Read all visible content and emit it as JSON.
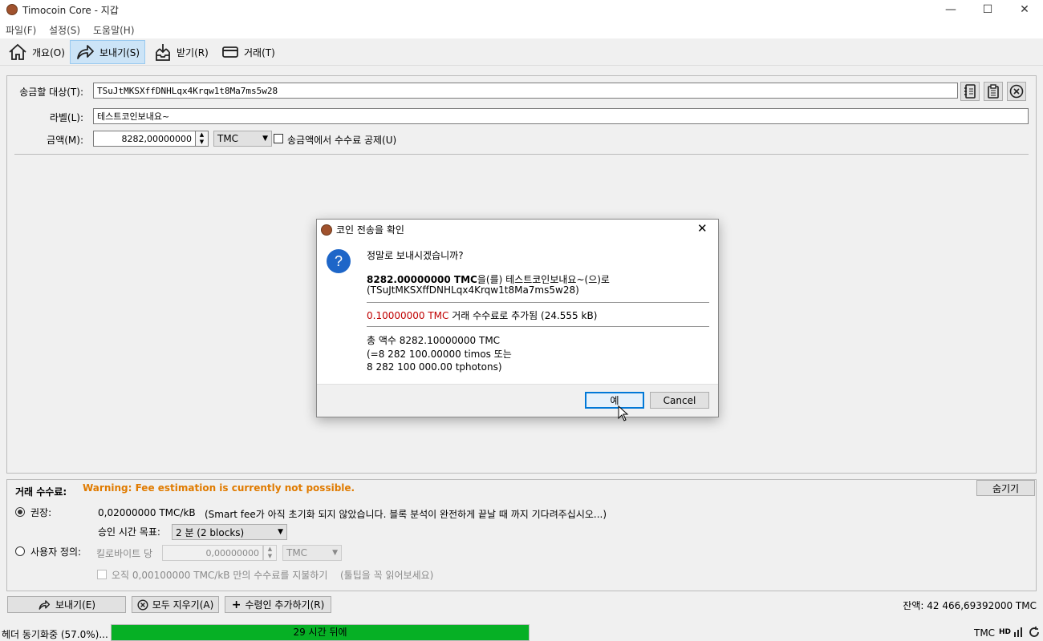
{
  "window": {
    "title": "Timocoin Core - 지갑",
    "minimize": "—",
    "maximize": "☐",
    "close": "✕"
  },
  "menu": [
    "파일(F)",
    "설정(S)",
    "도움말(H)"
  ],
  "tabs": [
    {
      "label": "개요(O)",
      "icon": "home-icon"
    },
    {
      "label": "보내기(S)",
      "icon": "send-arrow-icon",
      "active": true
    },
    {
      "label": "받기(R)",
      "icon": "inbox-icon"
    },
    {
      "label": "거래(T)",
      "icon": "card-icon"
    }
  ],
  "send_form": {
    "pay_to_label": "송금할 대상(T):",
    "pay_to_value": "TSuJtMKSXffDNHLqx4Krqw1t8Ma7ms5w28",
    "label_label": "라벨(L):",
    "label_value": "테스트코인보내요~",
    "amount_label": "금액(M):",
    "amount_value": "8282,00000000",
    "unit": "TMC",
    "subtract_fee_label": "송금액에서 수수료 공제(U)"
  },
  "dialog": {
    "title": "코인 전송을 확인",
    "question": "정말로 보내시겠습니까?",
    "amount_bold": "8282.00000000 TMC",
    "amount_rest": "을(를) 테스트코인보내요~(으)로",
    "address_line": "(TSuJtMKSXffDNHLqx4Krqw1t8Ma7ms5w28)",
    "fee_red": "0.10000000 TMC",
    "fee_rest": " 거래 수수료로 추가됨 (24.555 kB)",
    "total_line1": "총 액수 8282.10000000 TMC",
    "total_line2": "(=8 282 100.00000 timos 또는",
    "total_line3": "8 282 100 000.00 tphotons)",
    "yes_button": "예",
    "cancel_button": "Cancel"
  },
  "fee": {
    "title": "거래 수수료:",
    "warning": "Warning: Fee estimation is currently not possible.",
    "hide_button": "숨기기",
    "recommended_label": "권장:",
    "recommended_value": "0,02000000 TMC/kB",
    "smart_fee_note": "(Smart fee가 아직 초기화 되지 않았습니다. 블록 분석이 완전하게 끝날 때 까지 기다려주십시오...)",
    "confirm_target_label": "승인 시간 목표:",
    "confirm_target_value": "2 분 (2 blocks)",
    "custom_label": "사용자 정의:",
    "per_kb_label": "킬로바이트 당",
    "custom_value": "0,00000000",
    "custom_unit": "TMC",
    "min_fee_label": "오직 0,00100000 TMC/kB 만의 수수료를 지불하기",
    "min_fee_note": "(툴팁을 꼭 읽어보세요)"
  },
  "actions": {
    "send": "보내기(E)",
    "clear_all": "모두 지우기(A)",
    "add_recipient": "수령인 추가하기(R)",
    "balance": "잔액: 42 466,69392000 TMC"
  },
  "status": {
    "sync_text": "헤더 동기화중 (57.0%)...",
    "progress_text": "29 시간 뒤에",
    "progress_fraction": 1.0,
    "unit": "TMC",
    "hd": "HD"
  },
  "colors": {
    "warning": "#e07b00",
    "fee_red": "#c00000",
    "progress": "#06b025",
    "accent": "#0078d7"
  }
}
